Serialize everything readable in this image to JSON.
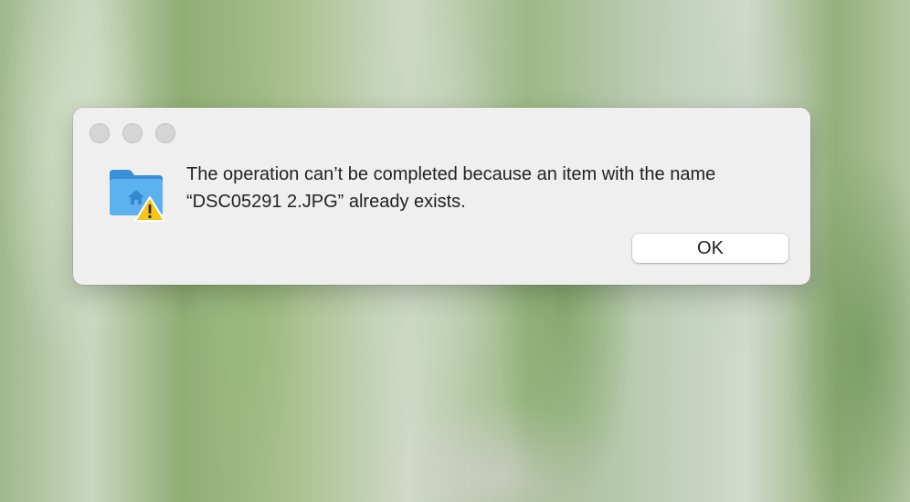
{
  "dialog": {
    "message": "The operation can’t be completed because an item with the name “DSC05291 2.JPG” already exists.",
    "ok_label": "OK",
    "icon": "folder-home-warning-icon",
    "traffic_lights": [
      "close",
      "minimize",
      "zoom"
    ]
  },
  "colors": {
    "dialog_background": "#efefef",
    "folder_blue": "#4aa3e4",
    "warning_yellow": "#f5c518"
  }
}
